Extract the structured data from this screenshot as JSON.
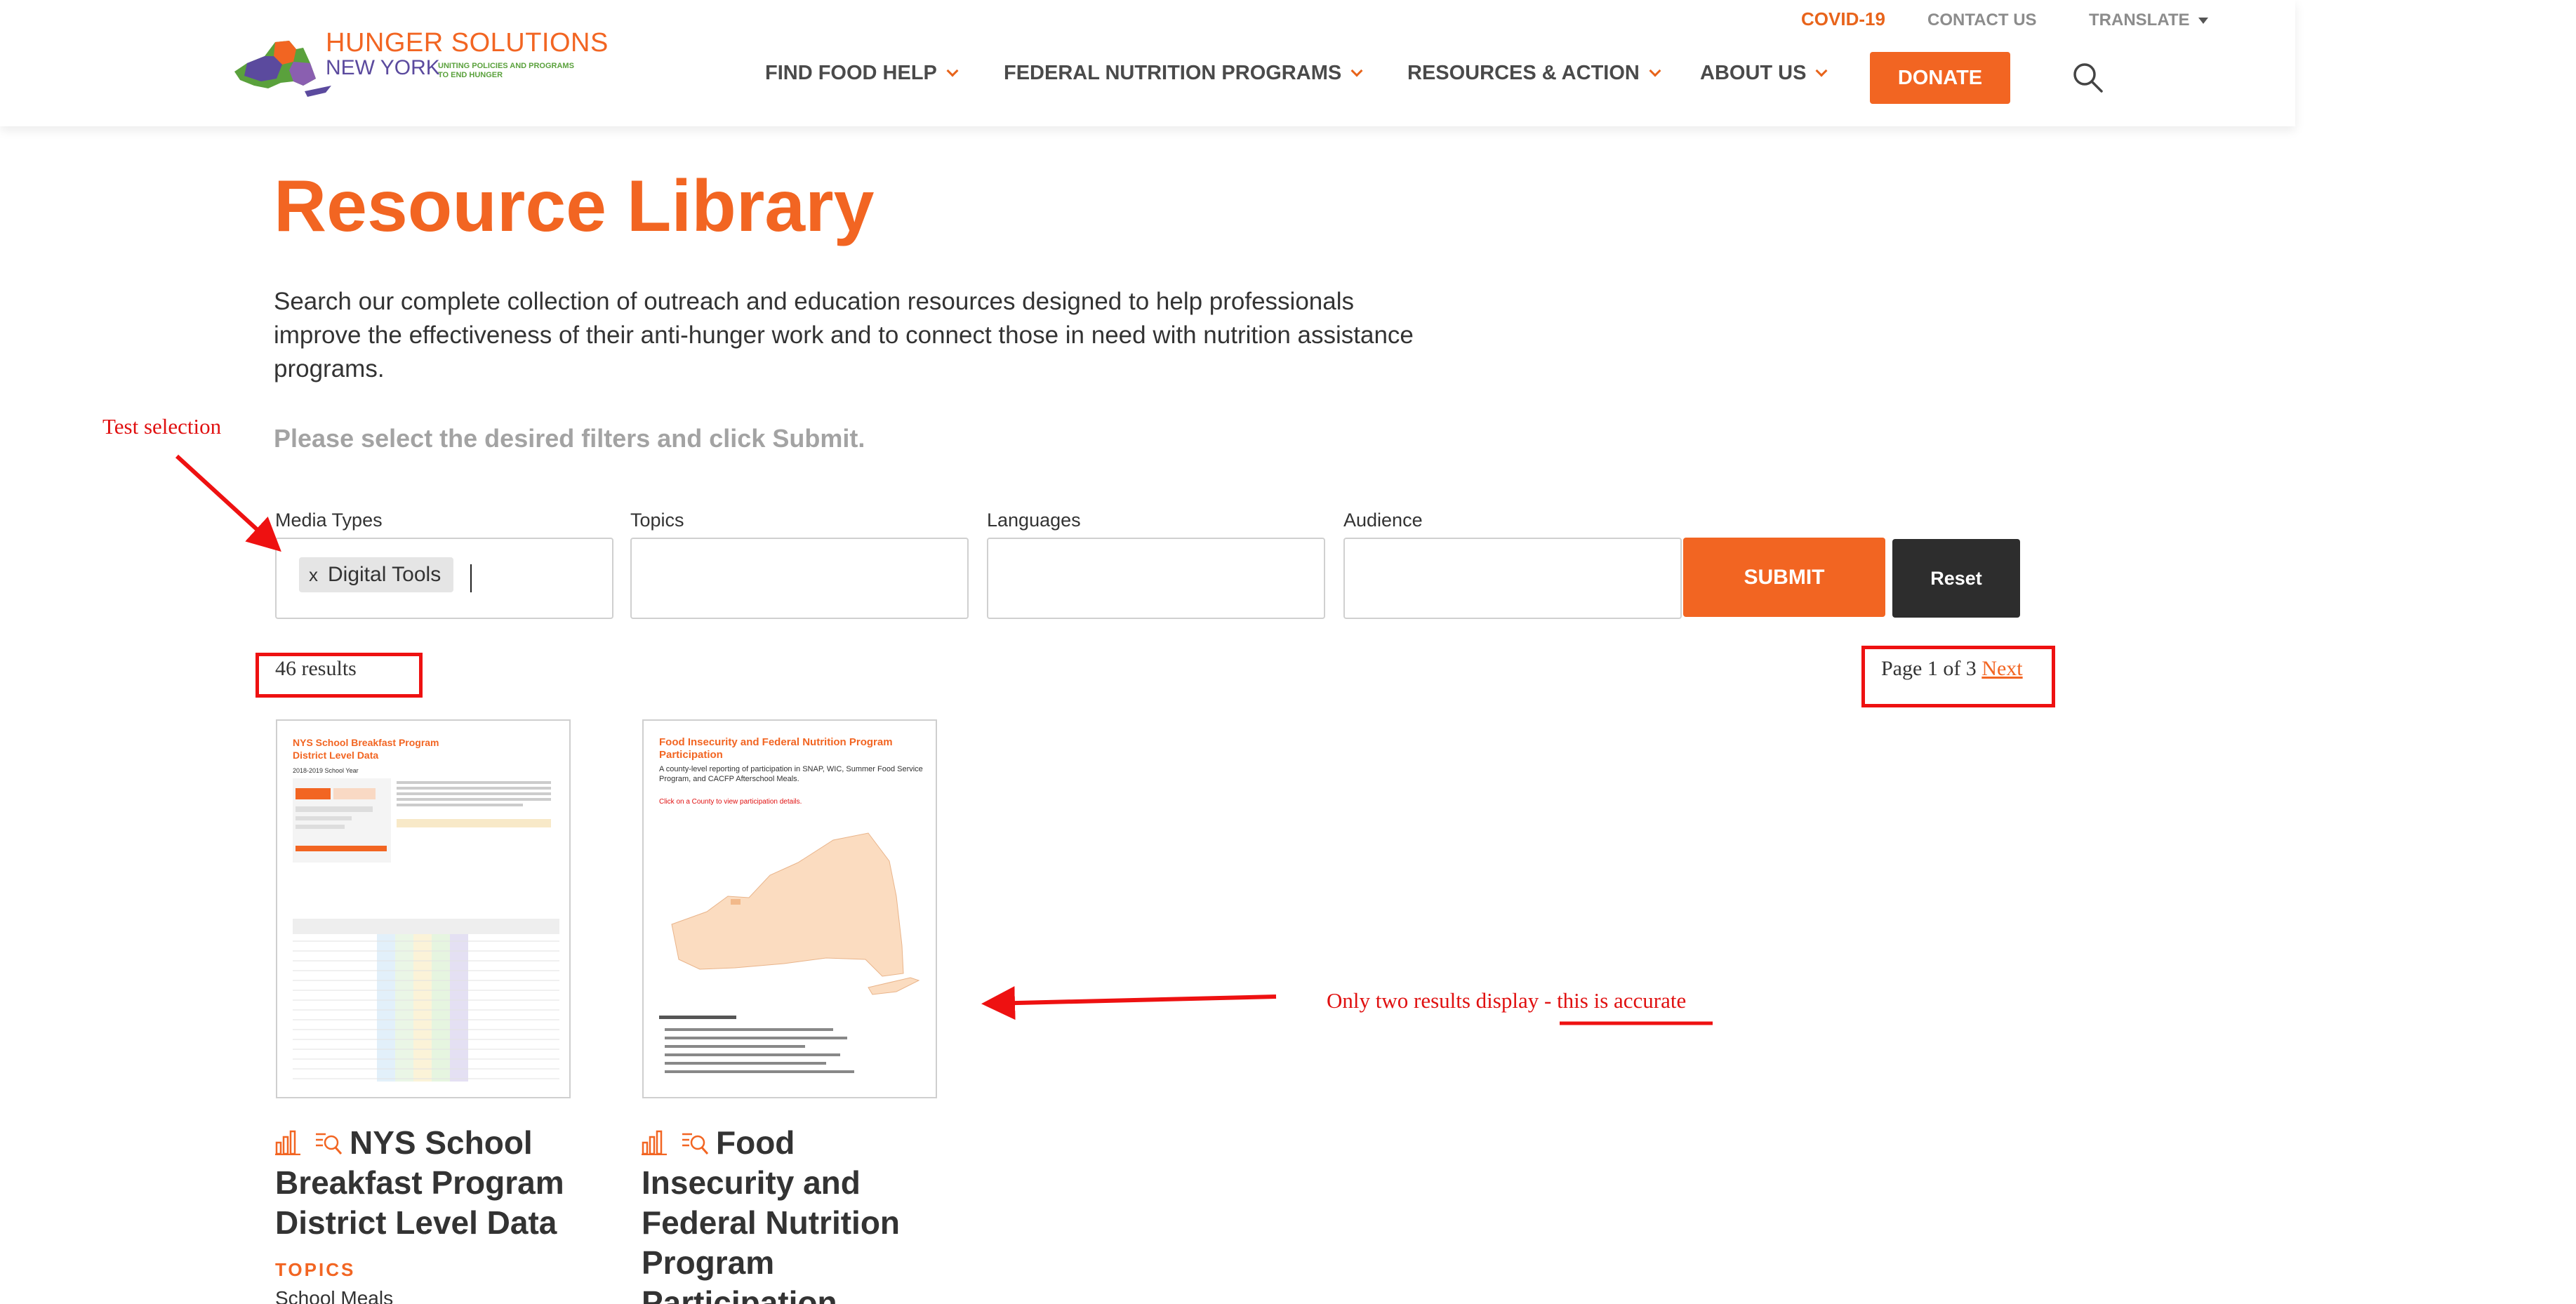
{
  "header": {
    "logo_title": "HUNGER SOLUTIONS",
    "logo_subtitle": "NEW YORK",
    "logo_tagline": "UNITING POLICIES AND PROGRAMS TO END HUNGER",
    "utility_nav": {
      "covid": "COVID-19",
      "contact": "CONTACT US",
      "translate": "TRANSLATE"
    },
    "main_nav": [
      "FIND FOOD HELP",
      "FEDERAL NUTRITION PROGRAMS",
      "RESOURCES & ACTION",
      "ABOUT US"
    ],
    "donate_label": "DONATE",
    "colors": {
      "brand_orange": "#f26522",
      "purple": "#5b4a9e",
      "green": "#5aa13c"
    }
  },
  "page": {
    "title": "Resource Library",
    "intro": "Search our complete collection of outreach and education resources designed to help professionals improve the effectiveness of their anti-hunger work and to connect those in need with nutrition assistance programs.",
    "instruction": "Please select the desired filters and click Submit."
  },
  "filters": {
    "media_types": {
      "label": "Media Types",
      "selected_chip": "Digital Tools",
      "chip_remove": "x"
    },
    "topics": {
      "label": "Topics"
    },
    "languages": {
      "label": "Languages"
    },
    "audience": {
      "label": "Audience"
    },
    "submit_label": "SUBMIT",
    "reset_label": "Reset"
  },
  "results": {
    "count_text": "46 results",
    "pager_text": "Page 1 of 3",
    "next_label": "Next"
  },
  "cards": [
    {
      "title": "NYS School Breakfast Program District Level Data",
      "thumb_title": "NYS School Breakfast Program District Level Data",
      "thumb_sub": "2018-2019 School Year",
      "topics_label": "TOPICS",
      "topics_value": "School Meals"
    },
    {
      "title": "Food Insecurity and Federal Nutrition Program Participation",
      "thumb_title": "Food Insecurity and Federal Nutrition Program Participation",
      "thumb_sub": "A county-level reporting of participation in SNAP, WIC, Summer Food Service Program, and CACFP Afterschool Meals.",
      "thumb_link": "Click on a County to view participation details."
    }
  ],
  "annotations": {
    "test_selection": "Test selection",
    "only_two_prefix": "Only two results display - ",
    "only_two_emphasis": "this is accurate",
    "color": "#ee1111"
  }
}
